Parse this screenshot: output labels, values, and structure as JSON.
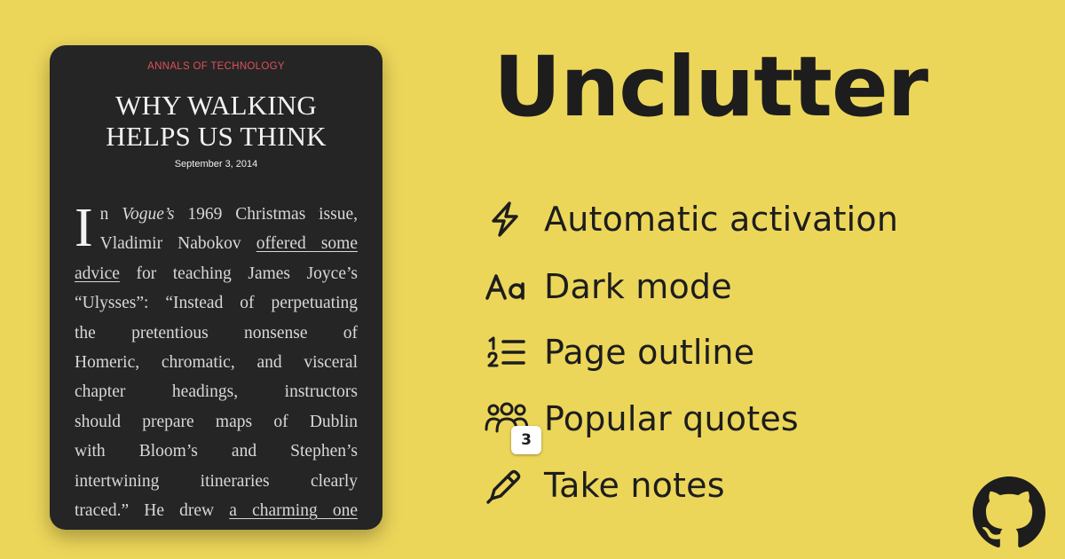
{
  "article": {
    "publication": "ANNALS OF TECHNOLOGY",
    "headline_line1": "WHY WALKING",
    "headline_line2": "HELPS US THINK",
    "date": "September 3, 2014",
    "dropcap": "I",
    "line1_a": "n ",
    "line1_em": "Vogue’s",
    "line1_b": " 1969 Christmas issue,",
    "line2_a": "Vladimir Nabokov ",
    "line2_link": "offered some",
    "line3_link": "advice",
    "line3_b": " for teaching James Joyce’s",
    "line4": "“Ulysses”: “Instead of perpetuating",
    "line5": "the pretentious nonsense of",
    "line6": "Homeric, chromatic, and visceral",
    "line7": "chapter headings, instructors",
    "line8": "should prepare maps of Dublin",
    "line9": "with Bloom’s and Stephen’s",
    "line10": "intertwining itineraries clearly",
    "line11_a": "traced.” He drew ",
    "line11_link": "a charming one"
  },
  "app": {
    "title": "Unclutter"
  },
  "features": [
    {
      "icon": "lightning-bolt-icon",
      "label": "Automatic activation"
    },
    {
      "icon": "font-aa-icon",
      "label": "Dark mode"
    },
    {
      "icon": "numbered-list-icon",
      "label": "Page outline"
    },
    {
      "icon": "users-group-icon",
      "label": "Popular quotes",
      "badge": "3"
    },
    {
      "icon": "pencil-icon",
      "label": "Take notes"
    }
  ],
  "links": {
    "github_icon": "github-icon"
  },
  "colors": {
    "background": "#ecd65a",
    "card": "#252525",
    "accent_red": "#e0505a",
    "text_dark": "#1d1d1d"
  }
}
